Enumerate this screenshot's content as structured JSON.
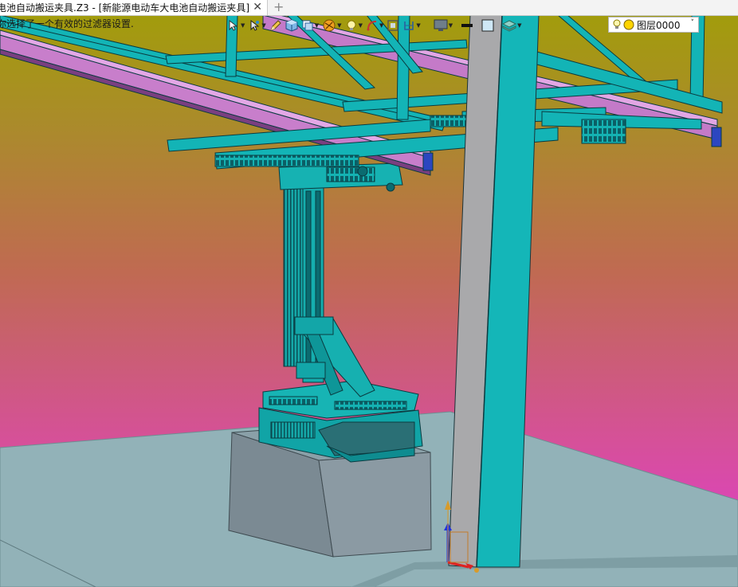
{
  "app": {
    "tab_title": "电池自动搬运夹具.Z3 - [新能源电动车大电池自动搬运夹具]",
    "tab_close_glyph": "✕",
    "new_tab_glyph": "+"
  },
  "status": {
    "line1": "需",
    "line2": "你选择了一个有效的过滤器设置."
  },
  "toolbar": {
    "icons": [
      "arrow-pick-icon",
      "cursor-icon",
      "pencil-icon",
      "cube-view-icon",
      "copy-view-icon",
      "render-mode-icon",
      "lightbulb-icon",
      "arc-icon",
      "frame-icon",
      "section-icon",
      "monitor-icon",
      "line-color-icon",
      "fill-color-icon",
      "layer-stack-icon"
    ]
  },
  "layer": {
    "name": "图层0000",
    "caret": "˅",
    "bulb_color": "#ffd400"
  },
  "colors": {
    "frame_cyan": "#0fb4b4",
    "rail_purple": "#c478c8",
    "floor": "#92b2b8",
    "column_face": "#a8a8aa",
    "column_side": "#12b4b6",
    "block": "#7f8f99"
  }
}
